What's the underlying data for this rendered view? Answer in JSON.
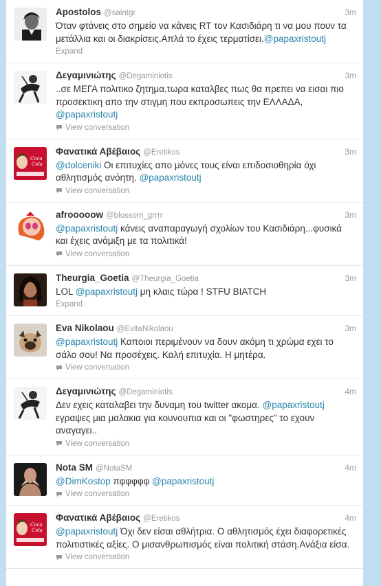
{
  "tweets": [
    {
      "fullname": "Apostolos",
      "screen_name": "@saintgr",
      "time": "3m",
      "avatar": "man-portrait-bw",
      "parts": [
        {
          "t": "Όταν φτάνεις στο σημείο να κάνεις RT τον Κασιδιάρη τι να μου πουν τα μετάλλια και οι διακρίσεις.Απλά το έχεις τερματίσει."
        },
        {
          "m": "@papaxristoutj"
        }
      ],
      "action": "Expand",
      "action_icon": ""
    },
    {
      "fullname": "Δεγαμινιώτης",
      "screen_name": "@Degaminiotis",
      "time": "3m",
      "avatar": "sketch-figure",
      "parts": [
        {
          "t": "..σε ΜΕΓΑ πολιτικο ζητημα.τωρα καταλβες πως θα πρεπει να εισαι πιο προσεκτικη απο την στιγμη που εκπροσωπεις την ΕΛΛΑΔΑ, "
        },
        {
          "m": "@papaxristoutj"
        }
      ],
      "action": "View conversation",
      "action_icon": "speech-bubble-icon"
    },
    {
      "fullname": "Φανατικά Αβέβαιος",
      "screen_name": "@Eretikos",
      "time": "3m",
      "avatar": "coca-cola-lenin",
      "parts": [
        {
          "m": "@dolceniki"
        },
        {
          "t": " Οι επιτυχίες απο μόνες τους είναι επιδοσιοθηρία όχι αθλητισμός ανόητη. "
        },
        {
          "m": "@papaxristoutj"
        }
      ],
      "action": "View conversation",
      "action_icon": "speech-bubble-icon"
    },
    {
      "fullname": "afrooooow",
      "screen_name": "@blossom_grrrr",
      "time": "3m",
      "avatar": "powerpuff-blossom",
      "parts": [
        {
          "m": "@papaxristoutj"
        },
        {
          "t": " κάνεις αναπαραγωγή σχολίων του Κασιδιάρη...φυσικά και έχεις ανάμιξη με τα πολιτικά!"
        }
      ],
      "action": "View conversation",
      "action_icon": "speech-bubble-icon"
    },
    {
      "fullname": "Theurgia_Goetia",
      "screen_name": "@Theurgia_Goetia",
      "time": "3m",
      "avatar": "woman-dark-hair",
      "parts": [
        {
          "t": "LOL "
        },
        {
          "m": "@papaxristoutj"
        },
        {
          "t": " μη κλαις τώρα ! STFU BIATCH"
        }
      ],
      "action": "Expand",
      "action_icon": ""
    },
    {
      "fullname": "Eva Nikolaou",
      "screen_name": "@EvitaNikolaou",
      "time": "3m",
      "avatar": "pug-dog",
      "parts": [
        {
          "m": "@papaxristoutj"
        },
        {
          "t": " Καποιοι περιμένουν να δουν ακόμη τι χρώμα εχει το σάλο σου! Να προσέχεις. Καλή επιτυχία. Η μητέρα."
        }
      ],
      "action": "View conversation",
      "action_icon": "speech-bubble-icon"
    },
    {
      "fullname": "Δεγαμινιώτης",
      "screen_name": "@Degaminiotis",
      "time": "4m",
      "avatar": "sketch-figure",
      "parts": [
        {
          "t": "Δεν εχεις καταλαβει την δυναμη του twitter ακομα. "
        },
        {
          "m": "@papaxristoutj"
        },
        {
          "t": " εγραψες μια μαλακια για κουνουπια και οι \"φωστηρες\" το εχουν αναγαγει.."
        }
      ],
      "action": "View conversation",
      "action_icon": "speech-bubble-icon"
    },
    {
      "fullname": "Nota SM",
      "screen_name": "@NotaSM",
      "time": "4m",
      "avatar": "person-hands",
      "parts": [
        {
          "m": "@DimKostop"
        },
        {
          "t": " πφφφφφ "
        },
        {
          "m": "@papaxristoutj"
        }
      ],
      "action": "View conversation",
      "action_icon": "speech-bubble-icon"
    },
    {
      "fullname": "Φανατικά Αβέβαιος",
      "screen_name": "@Eretikos",
      "time": "4m",
      "avatar": "coca-cola-lenin",
      "parts": [
        {
          "m": "@papaxristoutj"
        },
        {
          "t": " Όχι δεν είσαι αθλήτρια. Ο αθλητισμός έχει διαφορετικές πολιτιστικές αξίες. Ο μισανθρωπισμός είναι πολιτική στάση.Ανάξια είσα."
        }
      ],
      "action": "View conversation",
      "action_icon": "speech-bubble-icon"
    }
  ],
  "colors": {
    "background": "#c0deed",
    "mention": "#2a84ad",
    "text": "#333333",
    "muted": "#999999"
  }
}
